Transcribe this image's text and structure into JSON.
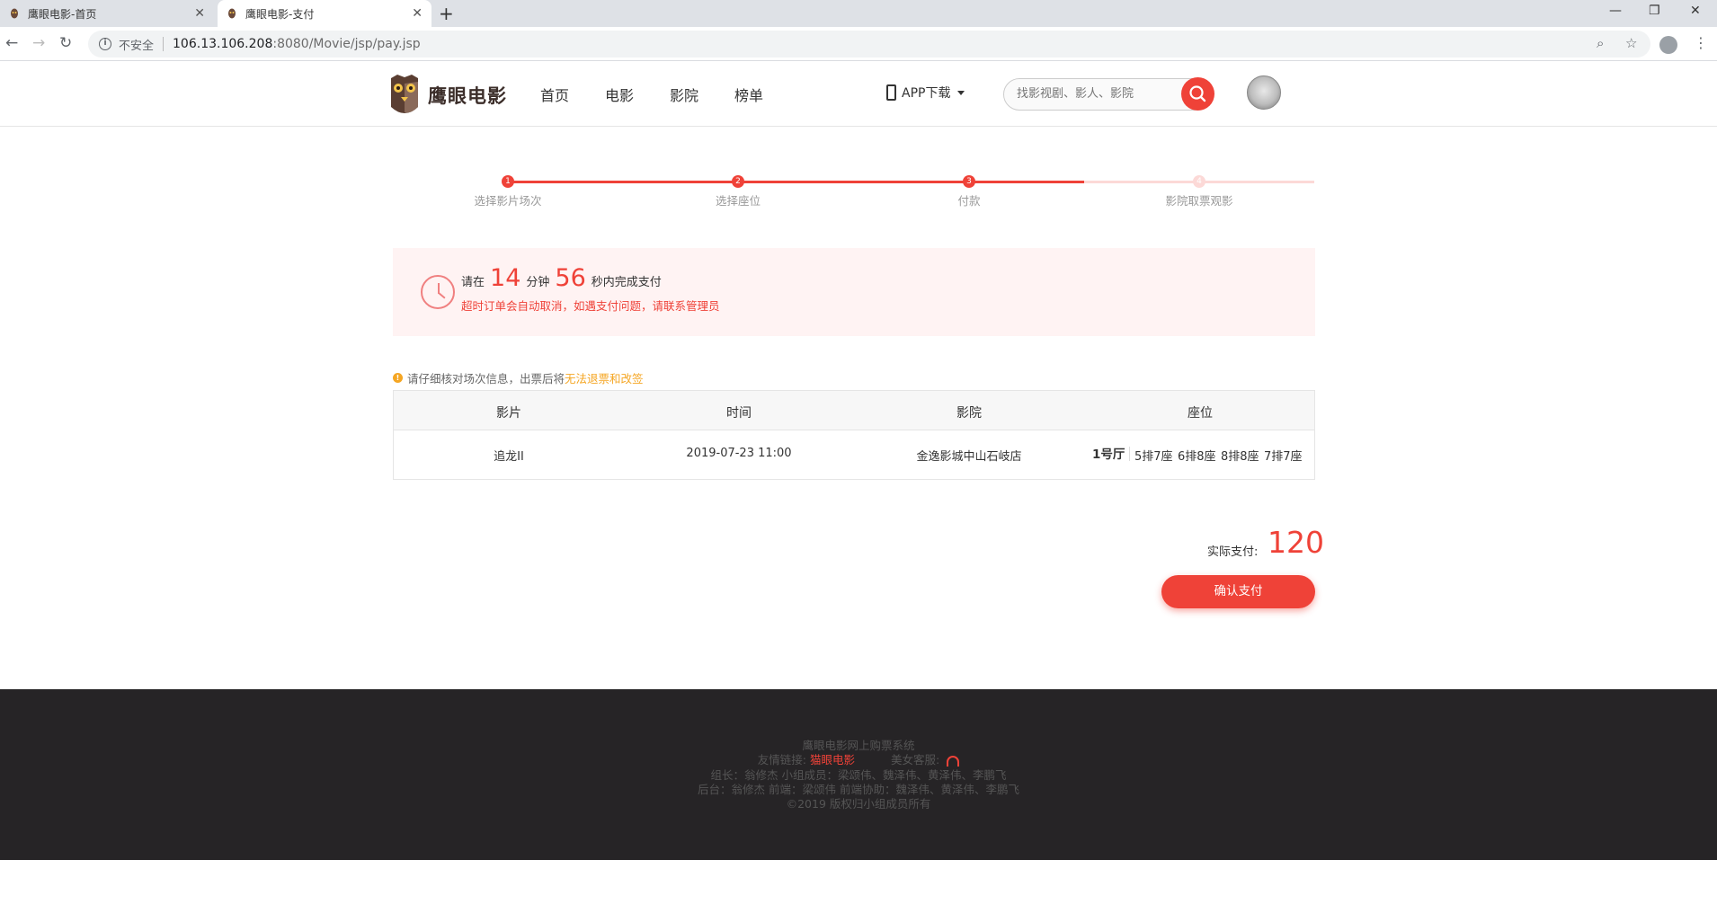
{
  "browser": {
    "tabs": [
      {
        "title": "鹰眼电影-首页",
        "active": false
      },
      {
        "title": "鹰眼电影-支付",
        "active": true
      }
    ],
    "new_tab": "+",
    "security_label": "不安全",
    "url_host": "106.13.106.208",
    "url_path": ":8080/Movie/jsp/pay.jsp"
  },
  "header": {
    "logo_text": "鹰眼电影",
    "nav": [
      "首页",
      "电影",
      "影院",
      "榜单"
    ],
    "app_download": "APP下载",
    "search_placeholder": "找影视剧、影人、影院"
  },
  "steps": [
    {
      "num": "1",
      "label": "选择影片场次",
      "done": true
    },
    {
      "num": "2",
      "label": "选择座位",
      "done": true
    },
    {
      "num": "3",
      "label": "付款",
      "done": true
    },
    {
      "num": "4",
      "label": "影院取票观影",
      "done": false
    }
  ],
  "timer": {
    "prefix": "请在",
    "minutes": "14",
    "min_unit": "分钟",
    "seconds": "56",
    "suffix": "秒内完成支付",
    "warning": "超时订单会自动取消，如遇支付问题，请联系管理员"
  },
  "notice": {
    "text": "请仔细核对场次信息，出票后将",
    "highlight": "无法退票和改签"
  },
  "table": {
    "headers": [
      "影片",
      "时间",
      "影院",
      "座位"
    ],
    "row": {
      "movie": "追龙II",
      "time": "2019-07-23 11:00",
      "cinema": "金逸影城中山石岐店",
      "hall": "1号厅",
      "seats": [
        "5排7座",
        "6排8座",
        "8排8座",
        "7排7座"
      ]
    }
  },
  "payment": {
    "label": "实际支付:",
    "amount": "120",
    "button": "确认支付"
  },
  "footer": {
    "line1": "鹰眼电影网上购票系统",
    "friend_label": "友情链接:",
    "friend_link": "猫眼电影",
    "service_label": "美女客服:",
    "line3": "组长：翁修杰 小组成员：梁颂伟、魏泽伟、黄泽伟、李鹏飞",
    "line4": "后台：翁修杰 前端：梁颂伟 前端协助：魏泽伟、黄泽伟、李鹏飞",
    "line5": "©2019 版权归小组成员所有"
  },
  "colors": {
    "accent": "#ef4238",
    "warning": "#f5a623",
    "footer_bg": "#262426",
    "timer_bg": "#fff3f3"
  }
}
